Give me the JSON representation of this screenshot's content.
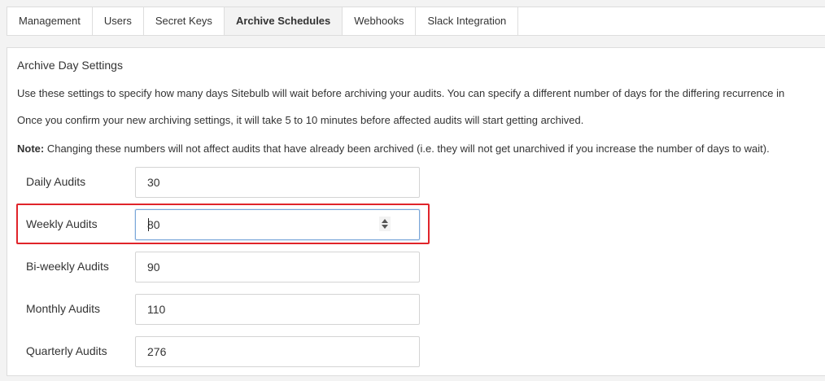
{
  "tabs": [
    {
      "label": "Management",
      "active": false
    },
    {
      "label": "Users",
      "active": false
    },
    {
      "label": "Secret Keys",
      "active": false
    },
    {
      "label": "Archive Schedules",
      "active": true
    },
    {
      "label": "Webhooks",
      "active": false
    },
    {
      "label": "Slack Integration",
      "active": false
    }
  ],
  "section": {
    "heading": "Archive Day Settings",
    "paragraph1": "Use these settings to specify how many days Sitebulb will wait before archiving your audits. You can specify a different number of days for the differing recurrence in",
    "paragraph2": "Once you confirm your new archiving settings, it will take 5 to 10 minutes before affected audits will start getting archived.",
    "note_label": "Note:",
    "note_text": " Changing these numbers will not affect audits that have already been archived (i.e. they will not get unarchived if you increase the number of days to wait)."
  },
  "fields": [
    {
      "label": "Daily Audits",
      "value": "30"
    },
    {
      "label": "Weekly Audits",
      "value": "80",
      "focused": true,
      "highlighted": true
    },
    {
      "label": "Bi-weekly Audits",
      "value": "90"
    },
    {
      "label": "Monthly Audits",
      "value": "110"
    },
    {
      "label": "Quarterly Audits",
      "value": "276"
    }
  ],
  "colors": {
    "highlight_border": "#e0242a",
    "active_tab_bg": "#f3f3f3",
    "focus_border": "#7aa7d9"
  }
}
